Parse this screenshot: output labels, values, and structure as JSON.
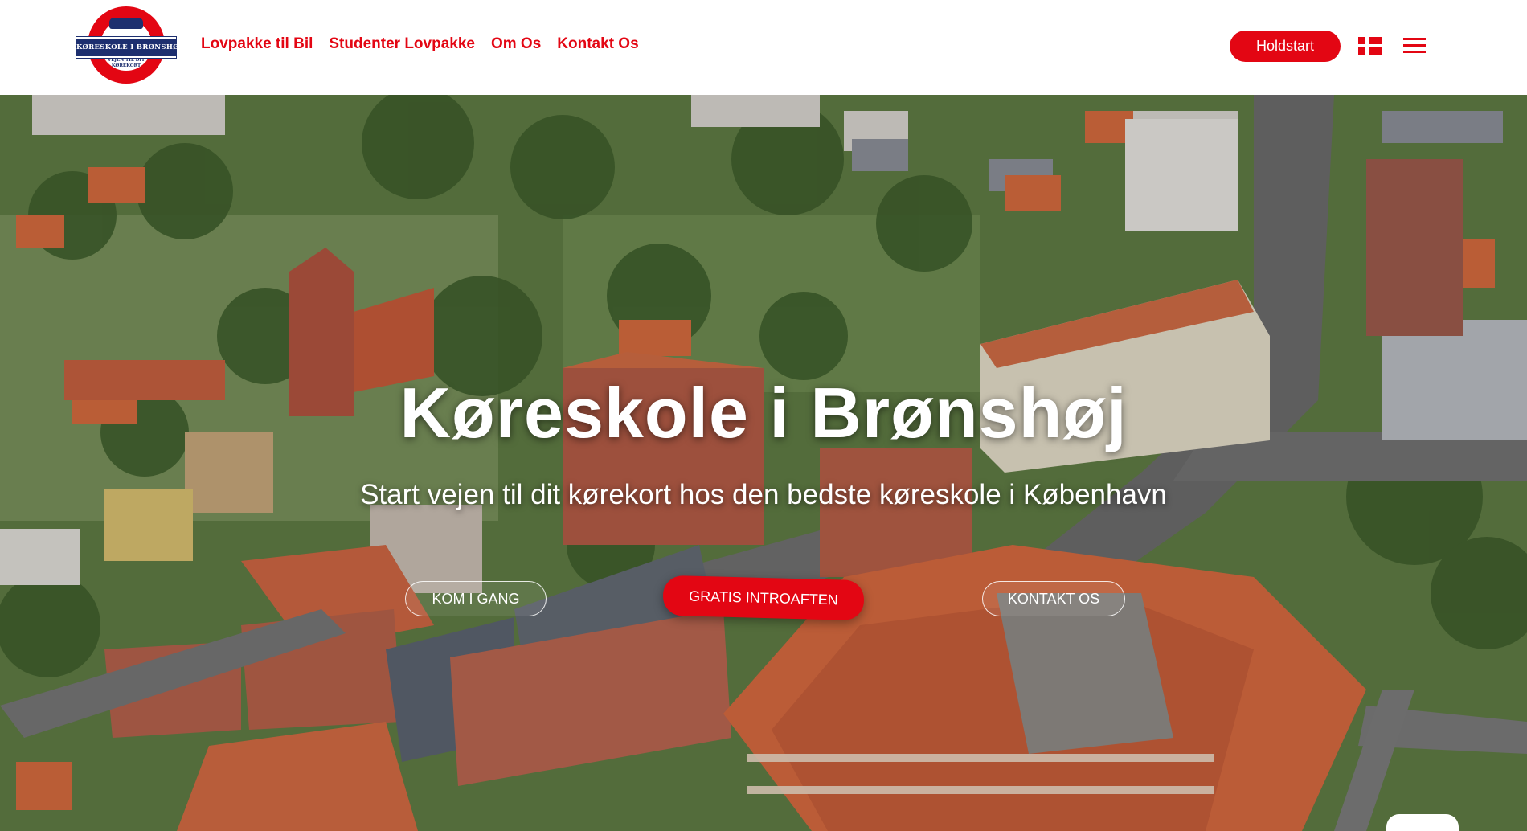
{
  "header": {
    "logo": {
      "name": "KØRESKOLE I BRØNSHØJ",
      "tagline": "VEJEN TIL DIT KØREKORT"
    },
    "nav": [
      {
        "label": "Lovpakke til Bil"
      },
      {
        "label": "Studenter Lovpakke"
      },
      {
        "label": "Om Os"
      },
      {
        "label": "Kontakt Os"
      }
    ],
    "holdstart_label": "Holdstart",
    "language_icon": "danish-flag-icon",
    "menu_icon": "hamburger-menu-icon"
  },
  "hero": {
    "title": "Køreskole i Brønshøj",
    "subtitle": "Start vejen til dit kørekort hos den bedste køreskole i København",
    "buttons": {
      "kom_i_gang": "KOM I GANG",
      "gratis_introaften": "GRATIS INTROAFTEN",
      "kontakt_os": "KONTAKT OS"
    }
  },
  "colors": {
    "brand_red": "#e30613",
    "logo_navy": "#1d2f6f"
  }
}
